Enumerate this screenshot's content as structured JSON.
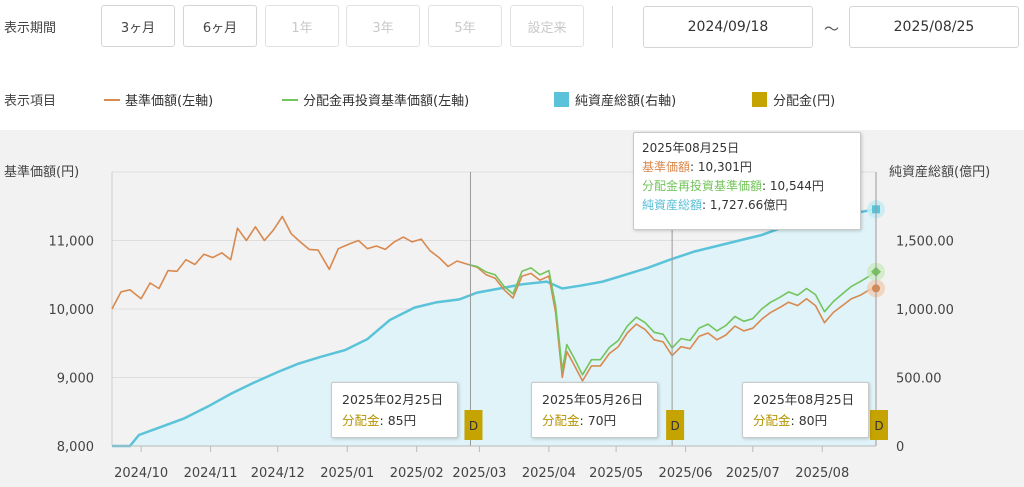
{
  "period": {
    "label": "表示期間",
    "buttons": [
      {
        "label": "3ヶ月",
        "enabled": true
      },
      {
        "label": "6ヶ月",
        "enabled": true
      },
      {
        "label": "1年",
        "enabled": false
      },
      {
        "label": "3年",
        "enabled": false
      },
      {
        "label": "5年",
        "enabled": false
      },
      {
        "label": "設定来",
        "enabled": false
      }
    ],
    "start_date": "2024/09/18",
    "separator": "～",
    "end_date": "2025/08/25"
  },
  "legend": {
    "label": "表示項目",
    "items": [
      {
        "name": "基準価額(左軸)",
        "color": "#d9894f",
        "kind": "line"
      },
      {
        "name": "分配金再投資基準価額(左軸)",
        "color": "#73c45c",
        "kind": "line"
      },
      {
        "name": "純資産総額(右軸)",
        "color": "#5bc3d9",
        "kind": "box"
      },
      {
        "name": "分配金(円)",
        "color": "#c5a300",
        "kind": "box"
      }
    ]
  },
  "tooltip": {
    "date": "2025年08月25日",
    "nav_label": "基準価額",
    "nav_value": "10,301円",
    "reinvest_label": "分配金再投資基準価額",
    "reinvest_value": "10,544円",
    "assets_label": "純資産総額",
    "assets_value": "1,727.66億円"
  },
  "dividend_tooltips": [
    {
      "date": "2025年02月25日",
      "label": "分配金",
      "value": "85円"
    },
    {
      "date": "2025年05月26日",
      "label": "分配金",
      "value": "70円"
    },
    {
      "date": "2025年08月25日",
      "label": "分配金",
      "value": "80円"
    }
  ],
  "chart_data": {
    "type": "line",
    "left_axis_label": "基準価額(円)",
    "right_axis_label": "純資産総額(億円)",
    "ylim_left": [
      8000,
      12000
    ],
    "ylim_right": [
      0,
      2000
    ],
    "left_ticks": [
      "8,000",
      "9,000",
      "10,000",
      "11,000"
    ],
    "right_ticks": [
      "0",
      "500.00",
      "1,000.00",
      "1,500.00"
    ],
    "x_ticks": [
      {
        "label": "2024/10",
        "date": "2024-10-01"
      },
      {
        "label": "2024/11",
        "date": "2024-11-01"
      },
      {
        "label": "2024/12",
        "date": "2024-12-01"
      },
      {
        "label": "2025/01",
        "date": "2025-01-01"
      },
      {
        "label": "2025/02",
        "date": "2025-02-01"
      },
      {
        "label": "2025/03",
        "date": "2025-03-01"
      },
      {
        "label": "2025/04",
        "date": "2025-04-01"
      },
      {
        "label": "2025/05",
        "date": "2025-05-01"
      },
      {
        "label": "2025/06",
        "date": "2025-06-01"
      },
      {
        "label": "2025/07",
        "date": "2025-07-01"
      },
      {
        "label": "2025/08",
        "date": "2025-08-01"
      }
    ],
    "series": [
      {
        "name": "基準価額(左軸)",
        "axis": "left",
        "color": "#d9894f",
        "points": [
          [
            "2024-09-18",
            10000
          ],
          [
            "2024-09-22",
            10250
          ],
          [
            "2024-09-26",
            10280
          ],
          [
            "2024-10-01",
            10150
          ],
          [
            "2024-10-05",
            10380
          ],
          [
            "2024-10-09",
            10300
          ],
          [
            "2024-10-13",
            10560
          ],
          [
            "2024-10-17",
            10550
          ],
          [
            "2024-10-21",
            10720
          ],
          [
            "2024-10-25",
            10650
          ],
          [
            "2024-10-29",
            10800
          ],
          [
            "2024-11-02",
            10750
          ],
          [
            "2024-11-06",
            10820
          ],
          [
            "2024-11-10",
            10720
          ],
          [
            "2024-11-13",
            11180
          ],
          [
            "2024-11-17",
            11000
          ],
          [
            "2024-11-21",
            11200
          ],
          [
            "2024-11-25",
            11000
          ],
          [
            "2024-11-29",
            11150
          ],
          [
            "2024-12-03",
            11350
          ],
          [
            "2024-12-07",
            11100
          ],
          [
            "2024-12-11",
            10980
          ],
          [
            "2024-12-15",
            10870
          ],
          [
            "2024-12-19",
            10860
          ],
          [
            "2024-12-24",
            10580
          ],
          [
            "2024-12-28",
            10880
          ],
          [
            "2025-01-02",
            10950
          ],
          [
            "2025-01-06",
            11000
          ],
          [
            "2025-01-10",
            10880
          ],
          [
            "2025-01-14",
            10920
          ],
          [
            "2025-01-18",
            10870
          ],
          [
            "2025-01-22",
            10980
          ],
          [
            "2025-01-26",
            11050
          ],
          [
            "2025-01-30",
            10980
          ],
          [
            "2025-02-03",
            11020
          ],
          [
            "2025-02-07",
            10850
          ],
          [
            "2025-02-11",
            10750
          ],
          [
            "2025-02-15",
            10620
          ],
          [
            "2025-02-19",
            10700
          ],
          [
            "2025-02-24",
            10650
          ],
          [
            "2025-02-28",
            10610
          ],
          [
            "2025-03-04",
            10500
          ],
          [
            "2025-03-08",
            10450
          ],
          [
            "2025-03-12",
            10280
          ],
          [
            "2025-03-16",
            10160
          ],
          [
            "2025-03-20",
            10480
          ],
          [
            "2025-03-24",
            10520
          ],
          [
            "2025-03-28",
            10420
          ],
          [
            "2025-04-01",
            10480
          ],
          [
            "2025-04-04",
            9950
          ],
          [
            "2025-04-07",
            9000
          ],
          [
            "2025-04-09",
            9380
          ],
          [
            "2025-04-12",
            9200
          ],
          [
            "2025-04-16",
            8950
          ],
          [
            "2025-04-20",
            9170
          ],
          [
            "2025-04-24",
            9170
          ],
          [
            "2025-04-28",
            9350
          ],
          [
            "2025-05-02",
            9450
          ],
          [
            "2025-05-06",
            9650
          ],
          [
            "2025-05-10",
            9780
          ],
          [
            "2025-05-14",
            9700
          ],
          [
            "2025-05-18",
            9550
          ],
          [
            "2025-05-22",
            9520
          ],
          [
            "2025-05-26",
            9320
          ],
          [
            "2025-05-30",
            9450
          ],
          [
            "2025-06-03",
            9420
          ],
          [
            "2025-06-07",
            9600
          ],
          [
            "2025-06-11",
            9650
          ],
          [
            "2025-06-15",
            9550
          ],
          [
            "2025-06-19",
            9620
          ],
          [
            "2025-06-23",
            9750
          ],
          [
            "2025-06-27",
            9680
          ],
          [
            "2025-07-01",
            9720
          ],
          [
            "2025-07-05",
            9850
          ],
          [
            "2025-07-09",
            9950
          ],
          [
            "2025-07-13",
            10020
          ],
          [
            "2025-07-17",
            10100
          ],
          [
            "2025-07-21",
            10050
          ],
          [
            "2025-07-25",
            10150
          ],
          [
            "2025-07-29",
            10050
          ],
          [
            "2025-08-02",
            9800
          ],
          [
            "2025-08-06",
            9950
          ],
          [
            "2025-08-10",
            10050
          ],
          [
            "2025-08-14",
            10150
          ],
          [
            "2025-08-18",
            10200
          ],
          [
            "2025-08-22",
            10280
          ],
          [
            "2025-08-25",
            10301
          ]
        ]
      },
      {
        "name": "分配金再投資基準価額(左軸)",
        "axis": "left",
        "color": "#73c45c",
        "points": [
          [
            "2025-02-24",
            10650
          ],
          [
            "2025-02-28",
            10620
          ],
          [
            "2025-03-04",
            10540
          ],
          [
            "2025-03-08",
            10500
          ],
          [
            "2025-03-12",
            10330
          ],
          [
            "2025-03-16",
            10220
          ],
          [
            "2025-03-20",
            10550
          ],
          [
            "2025-03-24",
            10600
          ],
          [
            "2025-03-28",
            10500
          ],
          [
            "2025-04-01",
            10560
          ],
          [
            "2025-04-04",
            10050
          ],
          [
            "2025-04-07",
            9100
          ],
          [
            "2025-04-09",
            9480
          ],
          [
            "2025-04-12",
            9300
          ],
          [
            "2025-04-16",
            9040
          ],
          [
            "2025-04-20",
            9260
          ],
          [
            "2025-04-24",
            9260
          ],
          [
            "2025-04-28",
            9440
          ],
          [
            "2025-05-02",
            9540
          ],
          [
            "2025-05-06",
            9750
          ],
          [
            "2025-05-10",
            9880
          ],
          [
            "2025-05-14",
            9800
          ],
          [
            "2025-05-18",
            9660
          ],
          [
            "2025-05-22",
            9630
          ],
          [
            "2025-05-26",
            9430
          ],
          [
            "2025-05-30",
            9570
          ],
          [
            "2025-06-03",
            9540
          ],
          [
            "2025-06-07",
            9720
          ],
          [
            "2025-06-11",
            9780
          ],
          [
            "2025-06-15",
            9680
          ],
          [
            "2025-06-19",
            9760
          ],
          [
            "2025-06-23",
            9890
          ],
          [
            "2025-06-27",
            9820
          ],
          [
            "2025-07-01",
            9860
          ],
          [
            "2025-07-05",
            10000
          ],
          [
            "2025-07-09",
            10100
          ],
          [
            "2025-07-13",
            10170
          ],
          [
            "2025-07-17",
            10250
          ],
          [
            "2025-07-21",
            10200
          ],
          [
            "2025-07-25",
            10300
          ],
          [
            "2025-07-29",
            10210
          ],
          [
            "2025-08-02",
            9960
          ],
          [
            "2025-08-06",
            10110
          ],
          [
            "2025-08-10",
            10220
          ],
          [
            "2025-08-14",
            10330
          ],
          [
            "2025-08-18",
            10400
          ],
          [
            "2025-08-22",
            10480
          ],
          [
            "2025-08-25",
            10544
          ]
        ]
      },
      {
        "name": "純資産総額(右軸)",
        "axis": "right",
        "color": "#5bc3d9",
        "points": [
          [
            "2024-09-18",
            0
          ],
          [
            "2024-09-26",
            0
          ],
          [
            "2024-09-30",
            80
          ],
          [
            "2024-10-10",
            140
          ],
          [
            "2024-10-20",
            200
          ],
          [
            "2024-10-31",
            290
          ],
          [
            "2024-11-10",
            380
          ],
          [
            "2024-11-20",
            460
          ],
          [
            "2024-12-01",
            540
          ],
          [
            "2024-12-10",
            600
          ],
          [
            "2024-12-20",
            650
          ],
          [
            "2024-12-31",
            700
          ],
          [
            "2025-01-10",
            780
          ],
          [
            "2025-01-20",
            920
          ],
          [
            "2025-01-31",
            1010
          ],
          [
            "2025-02-10",
            1050
          ],
          [
            "2025-02-20",
            1070
          ],
          [
            "2025-02-28",
            1120
          ],
          [
            "2025-03-10",
            1150
          ],
          [
            "2025-03-20",
            1180
          ],
          [
            "2025-03-31",
            1200
          ],
          [
            "2025-04-07",
            1150
          ],
          [
            "2025-04-15",
            1170
          ],
          [
            "2025-04-25",
            1200
          ],
          [
            "2025-05-05",
            1250
          ],
          [
            "2025-05-15",
            1300
          ],
          [
            "2025-05-25",
            1360
          ],
          [
            "2025-06-05",
            1420
          ],
          [
            "2025-06-15",
            1460
          ],
          [
            "2025-06-25",
            1500
          ],
          [
            "2025-07-05",
            1540
          ],
          [
            "2025-07-15",
            1600
          ],
          [
            "2025-07-25",
            1650
          ],
          [
            "2025-08-05",
            1670
          ],
          [
            "2025-08-15",
            1700
          ],
          [
            "2025-08-25",
            1727.66
          ]
        ]
      }
    ],
    "dividends": [
      {
        "date": "2025-02-25",
        "amount": 85,
        "marker": "D"
      },
      {
        "date": "2025-05-26",
        "amount": 70,
        "marker": "D"
      },
      {
        "date": "2025-08-25",
        "amount": 80,
        "marker": "D"
      }
    ]
  }
}
